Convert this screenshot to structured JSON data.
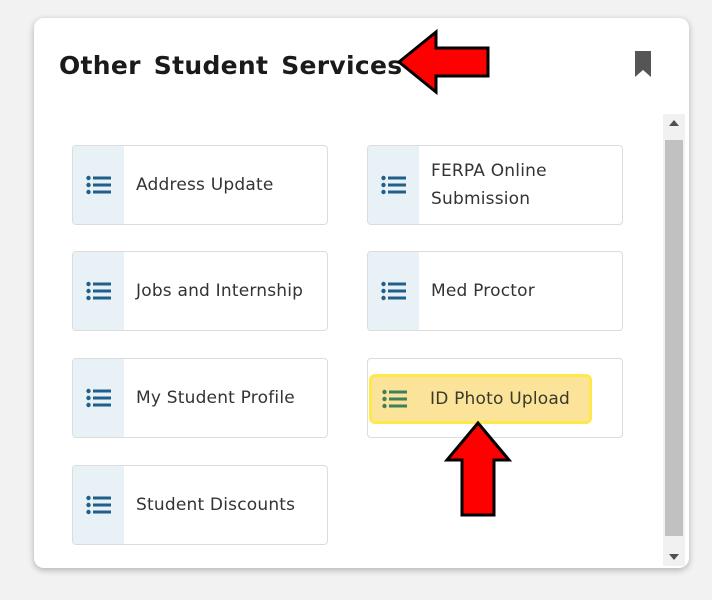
{
  "card": {
    "title": "Other Student Services"
  },
  "tiles": [
    {
      "label": "Address Update",
      "icon": "list-icon"
    },
    {
      "label": "FERPA Online Submission",
      "icon": "list-icon"
    },
    {
      "label": "Jobs and Internship",
      "icon": "list-icon"
    },
    {
      "label": "Med Proctor",
      "icon": "list-icon"
    },
    {
      "label": "My Student Profile",
      "icon": "list-icon"
    },
    {
      "label": "ID Photo Upload",
      "icon": "list-icon",
      "highlighted": true
    },
    {
      "label": "Student Discounts",
      "icon": "list-icon"
    }
  ],
  "colors": {
    "icon": "#1f5f8b",
    "highlight_fill": "#fbe39a",
    "highlight_border": "#ffe94a",
    "annotation_arrow": "#ff0000",
    "bookmark": "#555555"
  }
}
